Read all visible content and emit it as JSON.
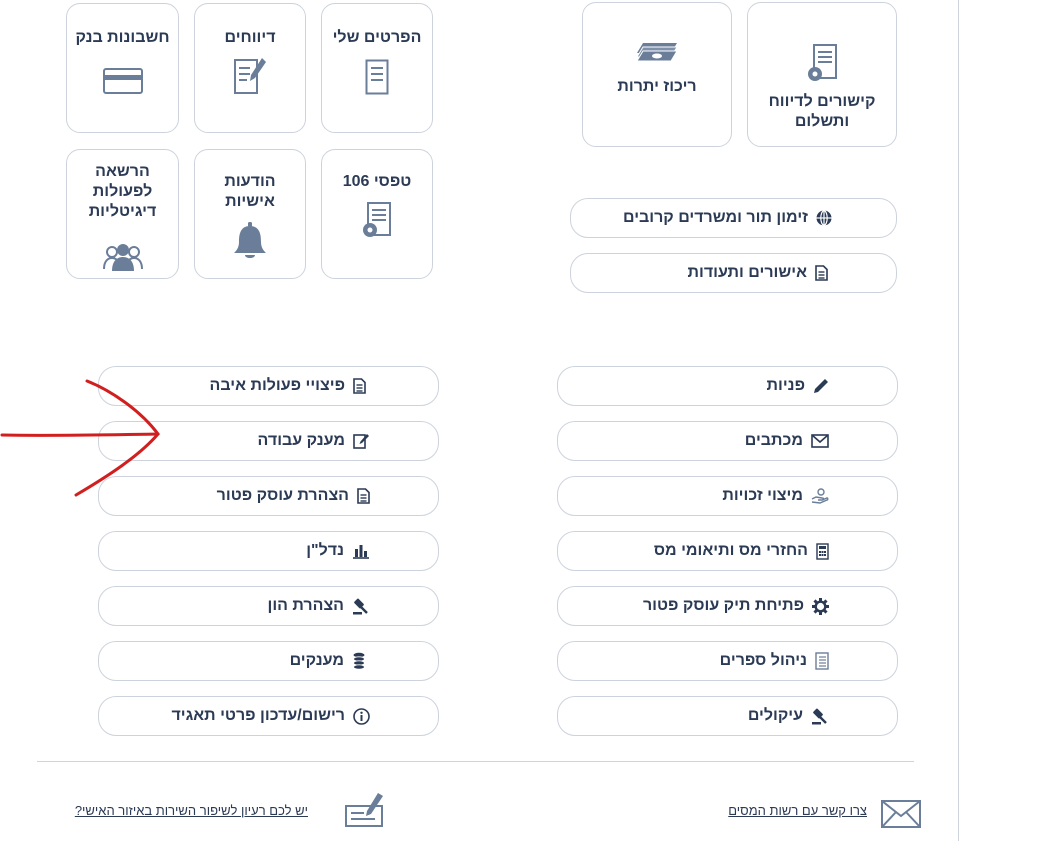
{
  "tiles": [
    {
      "label": "הפרטים שלי",
      "icon": "document-icon"
    },
    {
      "label": "דיווחים",
      "icon": "document-edit-icon"
    },
    {
      "label": "חשבונות בנק",
      "icon": "credit-card-icon"
    },
    {
      "label": "טפסי 106",
      "icon": "document-gear-icon"
    },
    {
      "label": "הודעות אישיות",
      "icon": "bell-icon"
    },
    {
      "label": "הרשאה לפעולות דיגיטליות",
      "icon": "users-icon"
    },
    {
      "label": "קישורים לדיווח ותשלום",
      "icon": "document-gear-icon"
    },
    {
      "label": "ריכוז יתרות",
      "icon": "money-stack-icon"
    }
  ],
  "top_links": [
    {
      "label": "זימון תור ומשרדים קרובים",
      "icon": "globe-icon"
    },
    {
      "label": "אישורים ותעודות",
      "icon": "document-icon"
    }
  ],
  "right_links": [
    {
      "label": "פניות",
      "icon": "pencil-icon"
    },
    {
      "label": "מכתבים",
      "icon": "envelope-icon"
    },
    {
      "label": "מיצוי זכויות",
      "icon": "hand-coin-icon"
    },
    {
      "label": "החזרי מס ותיאומי מס",
      "icon": "calculator-icon"
    },
    {
      "label": "פתיחת תיק עוסק פטור",
      "icon": "gear-icon"
    },
    {
      "label": "ניהול ספרים",
      "icon": "ledger-icon"
    },
    {
      "label": "עיקולים",
      "icon": "gavel-icon"
    }
  ],
  "left_links": [
    {
      "label": "פיצויי פעולות איבה",
      "icon": "document-icon"
    },
    {
      "label": "מענק עבודה",
      "icon": "document-edit-icon"
    },
    {
      "label": "הצהרת עוסק פטור",
      "icon": "document-icon"
    },
    {
      "label": "נדל\"ן",
      "icon": "bar-chart-icon"
    },
    {
      "label": "הצהרת הון",
      "icon": "gavel-icon"
    },
    {
      "label": "מענקים",
      "icon": "coins-icon"
    },
    {
      "label": "רישום/עדכון פרטי תאגיד",
      "icon": "info-icon"
    }
  ],
  "footer": {
    "contact_label": "צרו קשר עם רשות המסים",
    "feedback_label": "יש לכם רעיון לשיפור השירות באיזור האישי?"
  },
  "colors": {
    "text": "#2b3a55",
    "icon": "#6b7e99",
    "border": "#cdd3dc",
    "annotation_arrow": "#d11f1f"
  }
}
